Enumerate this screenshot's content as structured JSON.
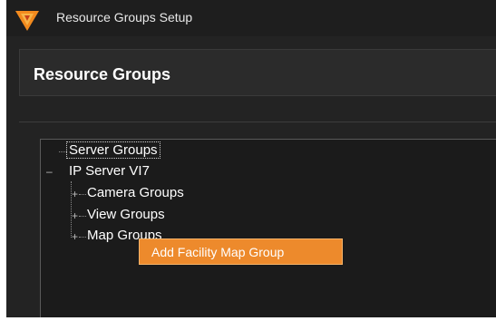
{
  "window": {
    "title": "Resource Groups Setup",
    "logo_icon": "app-logo-icon"
  },
  "header": {
    "title": "Resource Groups"
  },
  "tree": {
    "root": {
      "label": "Server Groups",
      "selected": true
    },
    "server": {
      "label": "IP Server VI7",
      "expanded": true
    },
    "children": [
      {
        "label": "Camera Groups"
      },
      {
        "label": "View Groups"
      },
      {
        "label": "Map Groups"
      }
    ]
  },
  "context_menu": {
    "items": [
      {
        "label": "Add Facility Map Group",
        "highlighted": true
      }
    ]
  },
  "colors": {
    "accent": "#ed8a2c",
    "background": "#232323",
    "text": "#ffffff"
  }
}
